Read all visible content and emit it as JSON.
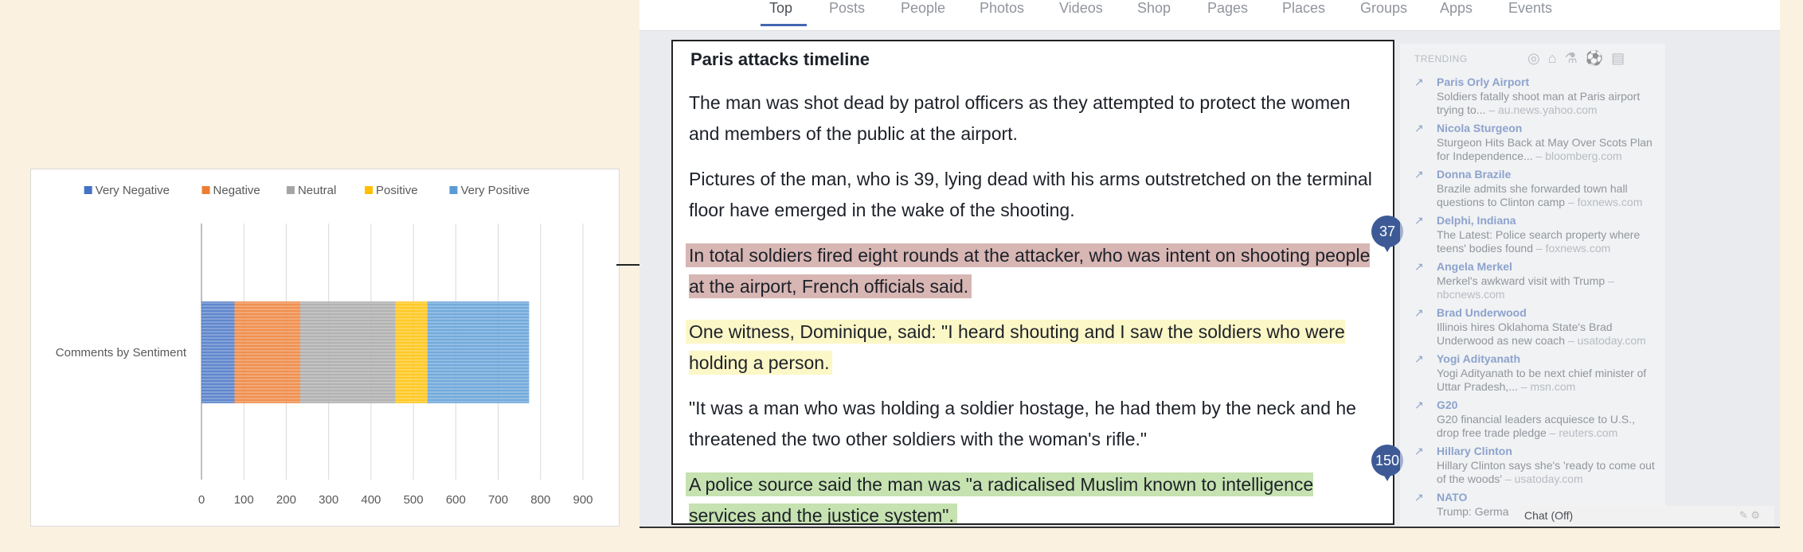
{
  "chart_data": {
    "type": "bar",
    "orientation": "horizontal",
    "stacked": true,
    "categories": [
      "Comments by Sentiment"
    ],
    "series": [
      {
        "name": "Very Negative",
        "values": [
          78
        ],
        "color": "#4472c4"
      },
      {
        "name": "Negative",
        "values": [
          155
        ],
        "color": "#ed7d31"
      },
      {
        "name": "Neutral",
        "values": [
          225
        ],
        "color": "#a5a5a5"
      },
      {
        "name": "Positive",
        "values": [
          75
        ],
        "color": "#ffc000"
      },
      {
        "name": "Very Positive",
        "values": [
          240
        ],
        "color": "#5b9bd5"
      }
    ],
    "xticks": [
      "0",
      "100",
      "200",
      "300",
      "400",
      "500",
      "600",
      "700",
      "800",
      "900"
    ],
    "xlim": [
      0,
      900
    ],
    "grid": true,
    "legend": "top"
  },
  "nav": {
    "tabs": [
      "Top",
      "Posts",
      "People",
      "Photos",
      "Videos",
      "Shop",
      "Pages",
      "Places",
      "Groups",
      "Apps",
      "Events"
    ]
  },
  "article": {
    "title": "Paris attacks timeline",
    "p1": "The man was shot dead by patrol officers as they attempted to protect the women and members of the public at the airport.",
    "p2": "Pictures of the man, who is 39, lying dead with his arms outstretched on the terminal floor have emerged in the wake of the shooting.",
    "p3": "In total soldiers fired eight rounds at the attacker, who was intent on shooting people at the airport, French officials said.",
    "p4": "One witness, Dominique, said: \"I heard shouting and I saw the soldiers who were holding a person.",
    "p5": "\"It was a man who was holding a soldier hostage, he had them by the neck and he threatened the two other soldiers with the woman's rifle.\"",
    "p6": "A police source said the man was \"a radicalised Muslim known to intelligence services and the justice system\".",
    "badge1": "37",
    "badge2": "150"
  },
  "trending": {
    "header": "TRENDING",
    "icons": [
      "trending-icon",
      "politics-icon",
      "science-icon",
      "sports-icon",
      "entertainment-icon"
    ],
    "items": [
      {
        "title": "Paris Orly Airport",
        "desc": "Soldiers fatally shoot man at Paris airport trying to...",
        "src": "– au.news.yahoo.com"
      },
      {
        "title": "Nicola Sturgeon",
        "desc": "Sturgeon Hits Back at May Over Scots Plan for Independence...",
        "src": "– bloomberg.com"
      },
      {
        "title": "Donna Brazile",
        "desc": "Brazile admits she forwarded town hall questions to Clinton camp",
        "src": "– foxnews.com"
      },
      {
        "title": "Delphi, Indiana",
        "desc": "The Latest: Police search property where teens' bodies found",
        "src": "– foxnews.com"
      },
      {
        "title": "Angela Merkel",
        "desc": "Merkel's awkward visit with Trump",
        "src": "– nbcnews.com"
      },
      {
        "title": "Brad Underwood",
        "desc": "Illinois hires Oklahoma State's Brad Underwood as new coach",
        "src": "– usatoday.com"
      },
      {
        "title": "Yogi Adityanath",
        "desc": "Yogi Adityanath to be next chief minister of Uttar Pradesh,...",
        "src": "– msn.com"
      },
      {
        "title": "G20",
        "desc": "G20 financial leaders acquiesce to U.S., drop free trade pledge",
        "src": "– reuters.com"
      },
      {
        "title": "Hillary Clinton",
        "desc": "Hillary Clinton says she's 'ready to come out of the woods'",
        "src": "– usatoday.com"
      },
      {
        "title": "NATO",
        "desc": "Trump: Germa",
        "src": ""
      }
    ]
  },
  "chat": {
    "label": "Chat (Off)"
  }
}
